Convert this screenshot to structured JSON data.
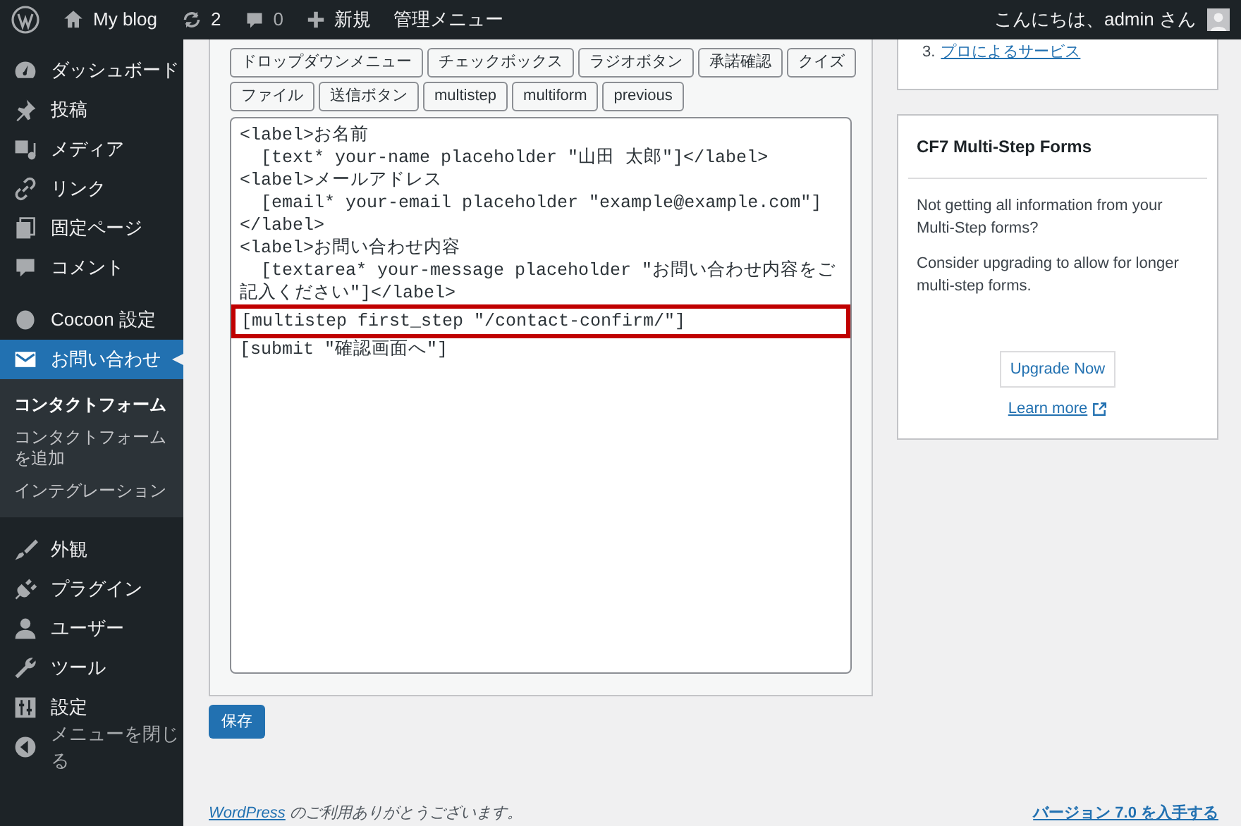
{
  "admin_bar": {
    "site": "My blog",
    "updates": "2",
    "comments": "0",
    "new": "新規",
    "menu": "管理メニュー",
    "greeting": "こんにちは、admin さん"
  },
  "sidebar": {
    "groups": [
      [
        {
          "label": "ダッシュボード",
          "selected": false
        },
        {
          "label": "投稿",
          "selected": false
        },
        {
          "label": "メディア",
          "selected": false
        },
        {
          "label": "リンク",
          "selected": false
        },
        {
          "label": "固定ページ",
          "selected": false
        },
        {
          "label": "コメント",
          "selected": false
        }
      ],
      [
        {
          "label": "Cocoon 設定",
          "selected": false
        },
        {
          "label": "お問い合わせ",
          "selected": true,
          "children": [
            {
              "label": "コンタクトフォーム",
              "selected": true
            },
            {
              "label": "コンタクトフォームを追加",
              "selected": false
            },
            {
              "label": "インテグレーション",
              "selected": false
            }
          ]
        }
      ],
      [
        {
          "label": "外観",
          "selected": false
        },
        {
          "label": "プラグイン",
          "selected": false
        },
        {
          "label": "ユーザー",
          "selected": false
        },
        {
          "label": "ツール",
          "selected": false
        },
        {
          "label": "設定",
          "selected": false
        },
        {
          "label": "メニューを閉じる",
          "selected": false
        }
      ]
    ]
  },
  "tag_buttons": [
    [
      "ドロップダウンメニュー",
      "チェックボックス",
      "ラジオボタン",
      "承諾確認",
      "クイズ"
    ],
    [
      "ファイル",
      "送信ボタン",
      "multistep",
      "multiform",
      "previous"
    ]
  ],
  "editor_lines": [
    {
      "text": "<label>お名前",
      "highlighted": false
    },
    {
      "text": "  [text* your-name placeholder \"山田 太郎\"]</label>",
      "highlighted": false
    },
    {
      "text": "<label>メールアドレス",
      "highlighted": false
    },
    {
      "text": "  [email* your-email placeholder \"example@example.com\"]",
      "highlighted": false
    },
    {
      "text": "</label>",
      "highlighted": false
    },
    {
      "text": "<label>お問い合わせ内容",
      "highlighted": false
    },
    {
      "text": "  [textarea* your-message placeholder \"お問い合わせ内容をご記入ください\"]</label>",
      "highlighted": false
    },
    {
      "text": "[multistep first_step \"/contact-confirm/\"]",
      "highlighted": true
    },
    {
      "text": "[submit \"確認画面へ\"]",
      "highlighted": false
    }
  ],
  "save_button": "保存",
  "side_cards": [
    {
      "kind": "list",
      "number": "3.",
      "link": "プロによるサービス"
    },
    {
      "kind": "promo",
      "title": "CF7 Multi-Step Forms",
      "paragraphs": [
        "Not getting all information from your Multi-Step forms?",
        "Consider upgrading to allow for longer multi-step forms."
      ],
      "button": "Upgrade Now",
      "link": "Learn more"
    }
  ],
  "footer": {
    "link": "WordPress",
    "text": " のご利用ありがとうございます。",
    "version_link": "バージョン 7.0 を入手する"
  }
}
